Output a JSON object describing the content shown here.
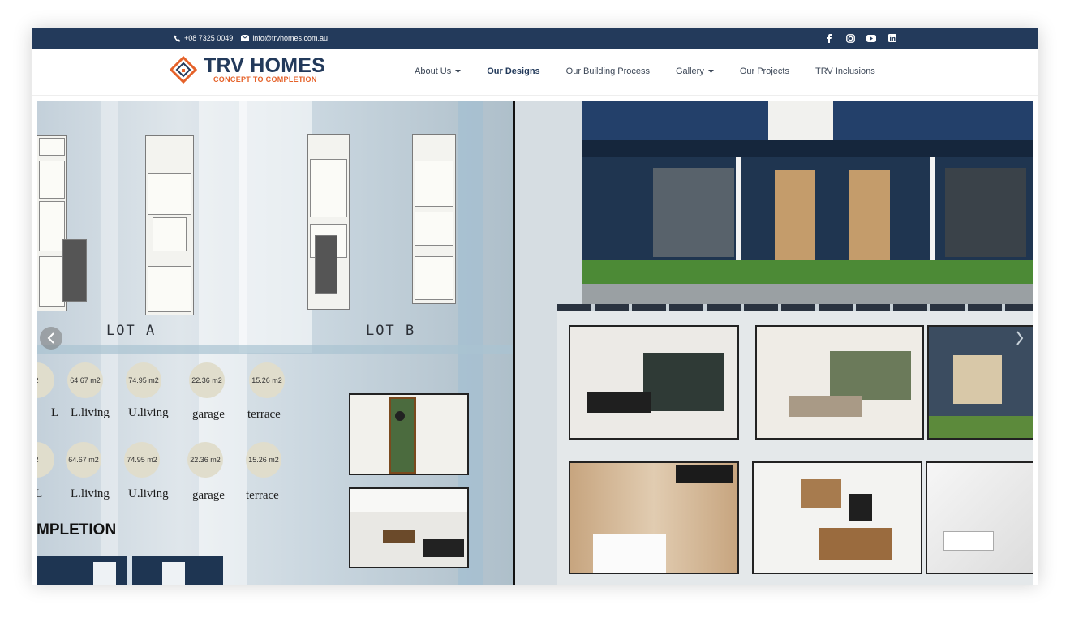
{
  "topbar": {
    "phone": "+08 7325 0049",
    "email": "info@trvhomes.com.au",
    "social": [
      "facebook-icon",
      "instagram-icon",
      "youtube-icon",
      "linkedin-icon"
    ]
  },
  "logo": {
    "name": "TRV HOMES",
    "tagline": "CONCEPT TO COMPLETION"
  },
  "nav": [
    {
      "label": "About Us",
      "dropdown": true
    },
    {
      "label": "Our Designs",
      "active": true
    },
    {
      "label": "Our Building Process"
    },
    {
      "label": "Gallery",
      "dropdown": true
    },
    {
      "label": "Our Projects"
    },
    {
      "label": "TRV Inclusions"
    }
  ],
  "hero": {
    "lot_a": "LOT A",
    "lot_b": "LOT B",
    "row1": {
      "values": [
        "2",
        "64.67 m2",
        "74.95 m2",
        "22.36 m2",
        "15.26 m2"
      ],
      "labels": [
        "L",
        "L.living",
        "U.living",
        "garage",
        "terrace"
      ]
    },
    "row2": {
      "values": [
        "2",
        "64.67 m2",
        "74.95 m2",
        "22.36 m2",
        "15.26 m2"
      ],
      "labels": [
        "L",
        "L.living",
        "U.living",
        "garage",
        "terrace"
      ]
    },
    "completion": "MPLETION"
  },
  "colors": {
    "navy": "#233a5b",
    "orange": "#e5622a"
  }
}
